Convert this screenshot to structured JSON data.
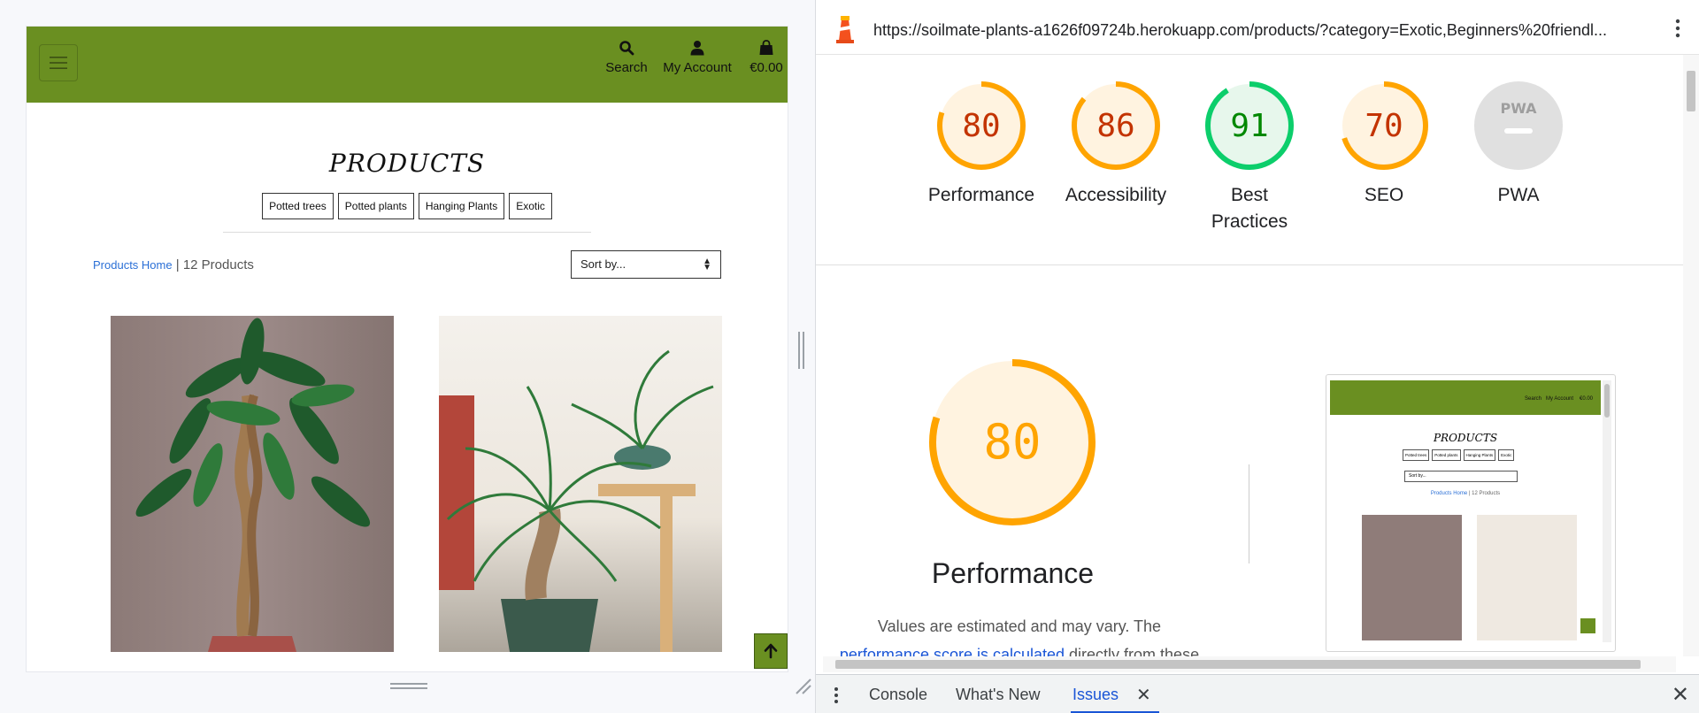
{
  "site": {
    "header": {
      "search_label": "Search",
      "account_label": "My Account",
      "bag_total": "€0.00"
    },
    "title": "PRODUCTS",
    "categories": [
      "Potted trees",
      "Potted plants",
      "Hanging Plants",
      "Exotic"
    ],
    "breadcrumb_link": "Products Home",
    "separator": " | ",
    "product_count": "12 Products",
    "sort_placeholder": "Sort by..."
  },
  "lighthouse": {
    "url": "https://soilmate-plants-a1626f09724b.herokuapp.com/products/?category=Exotic,Beginners%20friendl...",
    "scores": [
      {
        "label": "Performance",
        "value": "80",
        "fraction": 0.8,
        "status": "average"
      },
      {
        "label": "Accessibility",
        "value": "86",
        "fraction": 0.86,
        "status": "average"
      },
      {
        "label": "Best Practices",
        "value": "91",
        "fraction": 0.91,
        "status": "pass"
      },
      {
        "label": "SEO",
        "value": "70",
        "fraction": 0.7,
        "status": "average"
      },
      {
        "label": "PWA",
        "value": "PWA",
        "fraction": 0,
        "status": "na"
      }
    ],
    "detail": {
      "score": "80",
      "fraction": 0.8,
      "title": "Performance",
      "desc_prefix": "Values are estimated and may vary. The ",
      "desc_link": "performance score is calculated",
      "desc_suffix": " directly from these"
    },
    "colors": {
      "average": "#ffa400",
      "average_text": "#c33300",
      "average_bg": "#fff3e0",
      "pass": "#0cce6b",
      "pass_text": "#008800",
      "pass_bg": "#e7f7ec",
      "na": "#e0e0e0"
    }
  },
  "devtools_drawer": {
    "tabs": [
      "Console",
      "What's New",
      "Issues"
    ],
    "active_tab": "Issues"
  }
}
